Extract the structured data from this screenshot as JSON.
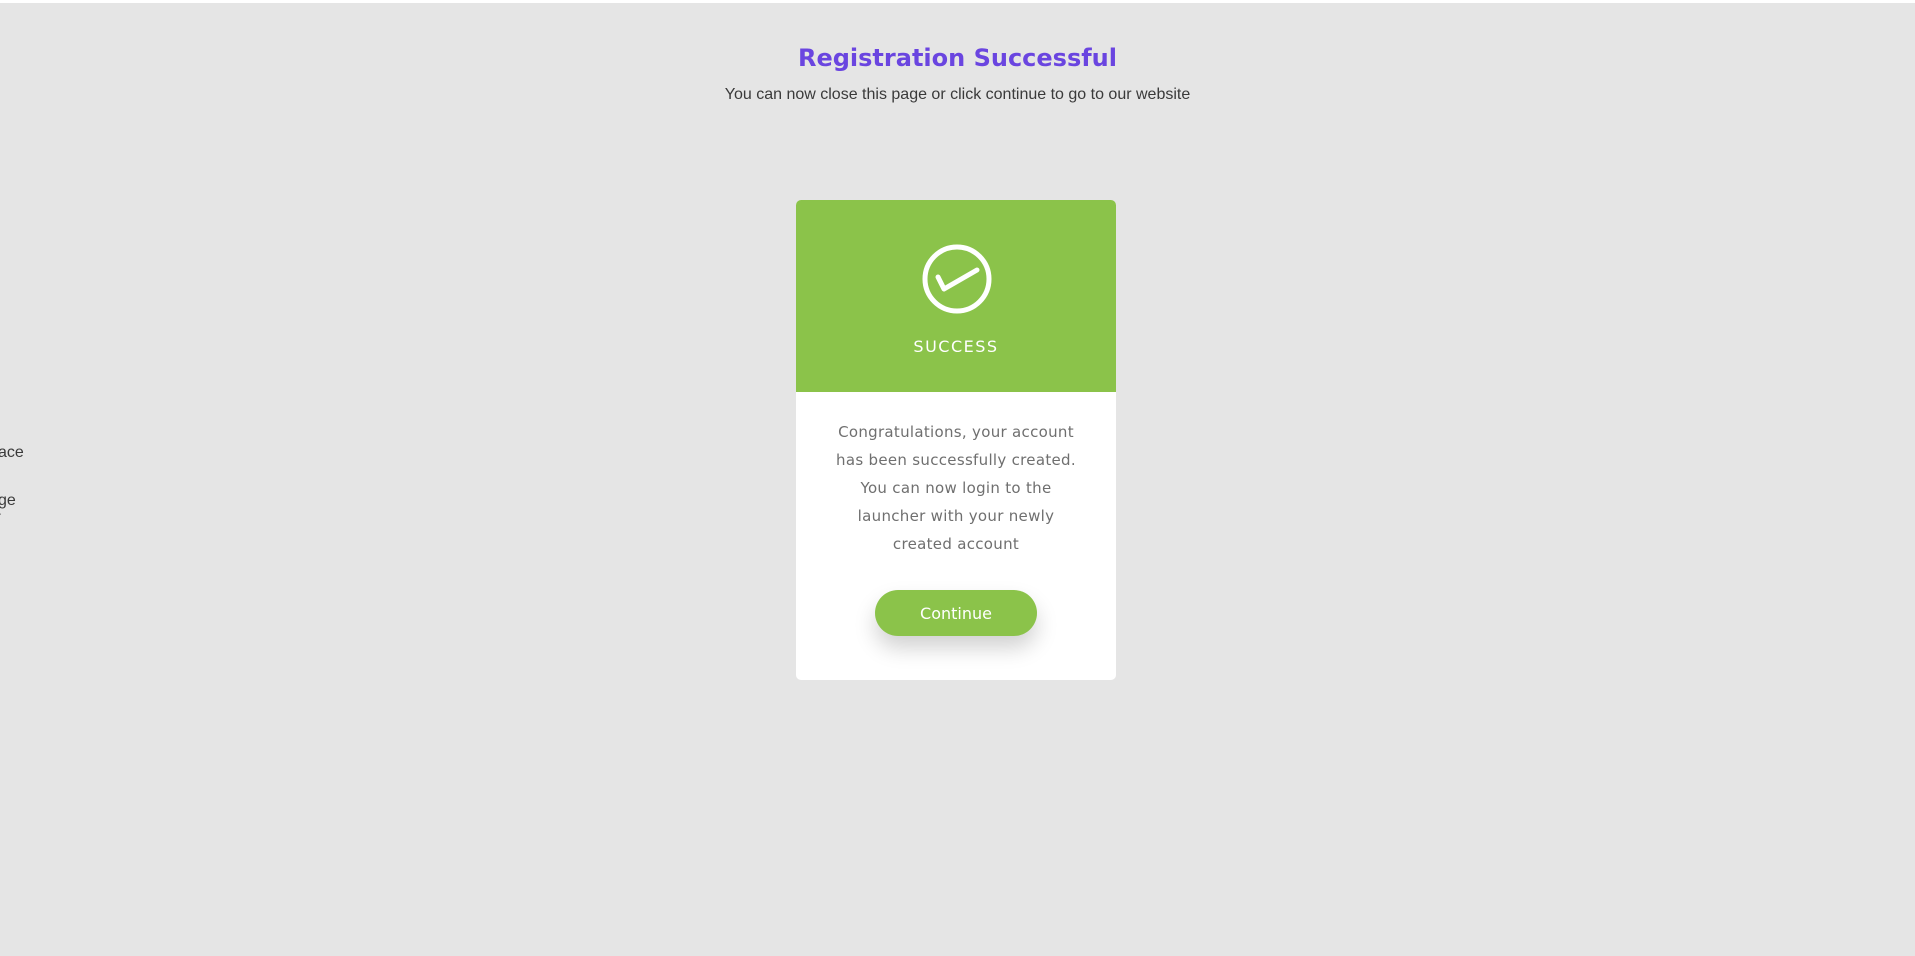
{
  "header": {
    "title": "Registration Successful",
    "subtitle": "You can now close this page or click continue to go to our website"
  },
  "stray_text": [
    "ace",
    "ge",
    "-"
  ],
  "card": {
    "status": "SUCCESS",
    "icon": "check-circle-icon",
    "message": "Congratulations, your account has been successfully created. You can now login to the launcher with your newly created account",
    "button_label": "Continue"
  },
  "colors": {
    "accent": "#8bc34a",
    "title": "#6a45e0",
    "background": "#e5e5e5"
  }
}
